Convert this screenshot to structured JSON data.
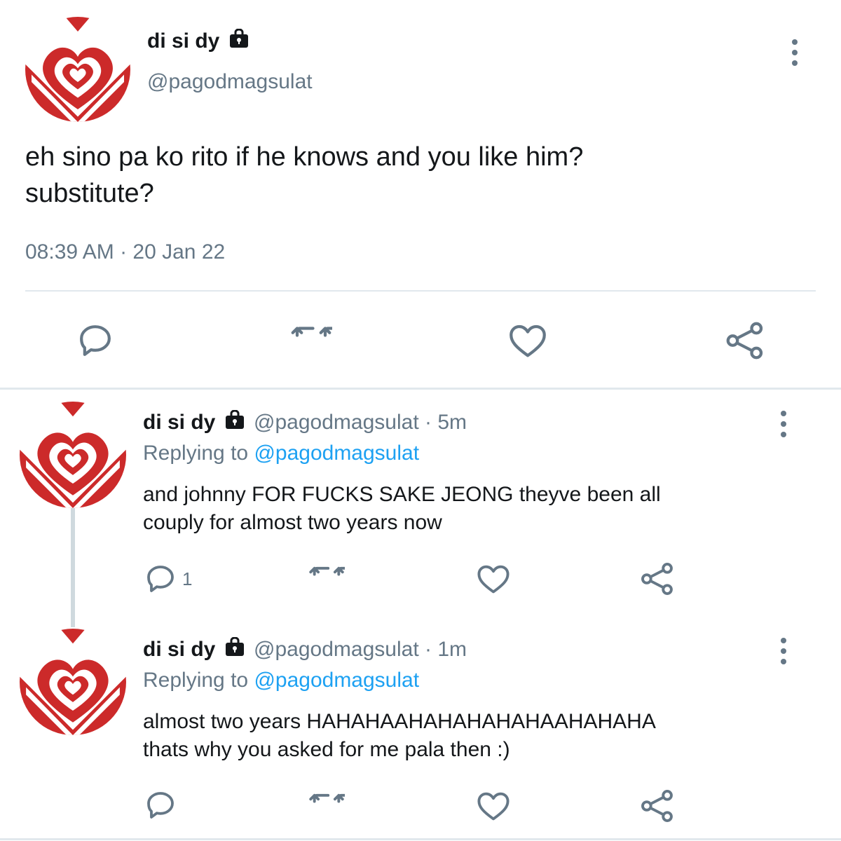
{
  "main_tweet": {
    "display_name": "di si dy",
    "handle": "@pagodmagsulat",
    "text_line1": "eh sino pa ko rito if he knows and you like him?",
    "text_line2": "substitute?",
    "timestamp": "08:39 AM · 20 Jan 22",
    "lock_icon": "lock-icon",
    "actions": [
      "reply-icon",
      "retweet-icon",
      "like-icon",
      "share-icon"
    ]
  },
  "replies": [
    {
      "display_name": "di si dy",
      "handle_time": "@pagodmagsulat · 5m",
      "replying_label": "Replying to",
      "replying_handle": "@pagodmagsulat",
      "text_line1": "and johnny FOR FUCKS SAKE JEONG theyve been all",
      "text_line2": "couply for almost two years now",
      "reply_count": "1"
    },
    {
      "display_name": "di si dy",
      "handle_time": "@pagodmagsulat · 1m",
      "replying_label": "Replying to",
      "replying_handle": "@pagodmagsulat",
      "text_line1": "almost two years HAHAHAAHAHAHAHAHAAHAHAHA",
      "text_line2": "thats why you asked for me pala then :)",
      "reply_count": ""
    }
  ],
  "colors": {
    "text": "#14171a",
    "secondary": "#657786",
    "link": "#1da1f2",
    "avatar_red": "#cc2a2a",
    "divider": "#e1e8ed"
  }
}
